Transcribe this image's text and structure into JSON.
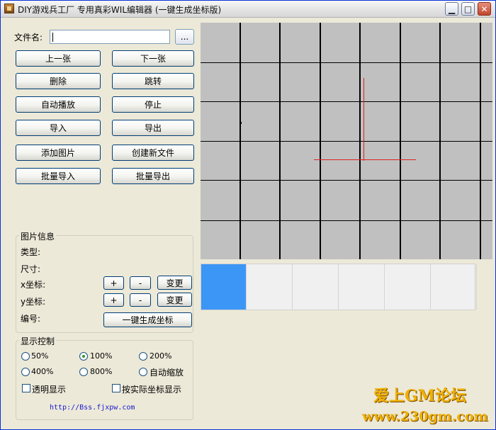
{
  "window": {
    "title": "DIY游戏兵工厂 专用真彩WIL编辑器 (一键生成坐标版)",
    "min_glyph": "▁",
    "max_glyph": "□",
    "close_glyph": "✕"
  },
  "file": {
    "label": "文件名:",
    "value": "",
    "browse_label": "..."
  },
  "buttons": {
    "prev": "上一张",
    "next": "下一张",
    "delete": "删除",
    "jump": "跳转",
    "autoplay": "自动播放",
    "stop": "停止",
    "import": "导入",
    "export": "导出",
    "add_image": "添加图片",
    "new_file": "创建新文件",
    "batch_import": "批量导入",
    "batch_export": "批量导出"
  },
  "image_info": {
    "title": "图片信息",
    "type_label": "类型:",
    "size_label": "尺寸:",
    "x_label": "x坐标:",
    "y_label": "y坐标:",
    "id_label": "编号:",
    "plus": "+",
    "minus": "-",
    "change": "变更",
    "generate": "一键生成坐标"
  },
  "display": {
    "title": "显示控制",
    "zoom_options": [
      "50%",
      "100%",
      "200%",
      "400%",
      "800%",
      "自动缩放"
    ],
    "selected_zoom": "100%",
    "transparent_label": "透明显示",
    "actual_coord_label": "按实际坐标显示",
    "link": "http://Bss.fjxpw.com"
  },
  "thumbnails": {
    "count": 6,
    "selected_index": 0,
    "selected_color": "#3c96f5"
  },
  "canvas": {
    "background": "#c0c0c0",
    "crosshair_color": "#dd2222"
  },
  "watermark": {
    "line1": "爱上GM论坛",
    "line2": "www.230gm.com"
  }
}
